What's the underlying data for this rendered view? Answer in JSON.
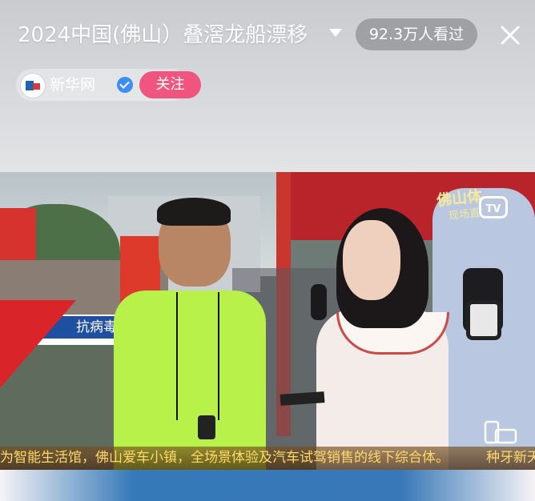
{
  "header": {
    "title": "2024中国(佛山）叠滘龙船漂移",
    "viewers": "92.3万人看过",
    "close_icon": "close-icon",
    "dropdown_icon": "chevron-down-icon"
  },
  "account": {
    "name": "新华网",
    "follow_label": "关注",
    "verified_icon": "verified-icon"
  },
  "video": {
    "overlay_sign_main": "佛山体",
    "overlay_sign_sub": "现场直",
    "tv_badge": "TV",
    "boat_sign": "抗病毒",
    "ticker_left": "为智能生活馆，佛山爱车小镇，全场景体验及汽车试驾销售的线下综合体。",
    "ticker_right": "种牙新天",
    "rotate_icon": "rotate-screen-icon"
  },
  "colors": {
    "follow": "#f0557f",
    "verified": "#3c8df5",
    "ticker_text": "#ffd86a"
  }
}
